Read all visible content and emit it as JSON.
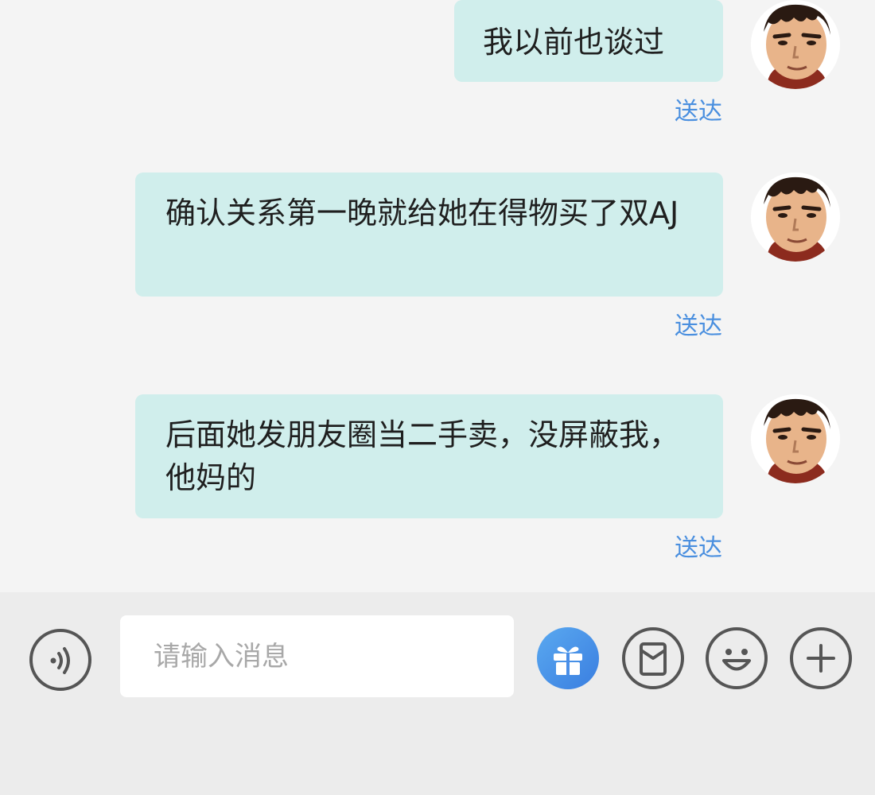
{
  "messages": [
    {
      "text": "我以前也谈过",
      "status": "送达"
    },
    {
      "text": "确认关系第一晚就给她在得物买了双AJ",
      "status": "送达"
    },
    {
      "text": "后面她发朋友圈当二手卖，没屏蔽我，他妈的",
      "status": "送达"
    }
  ],
  "input": {
    "placeholder": "请输入消息"
  },
  "toolbar": {
    "voice_icon": "voice-icon",
    "gift_icon": "gift-icon",
    "red_packet_icon": "red-packet-icon",
    "emoji_icon": "emoji-icon",
    "more_icon": "plus-icon"
  },
  "colors": {
    "bubble": "#d0eeec",
    "status": "#4a8fdf",
    "gift_accent": "#3a8fe8"
  }
}
